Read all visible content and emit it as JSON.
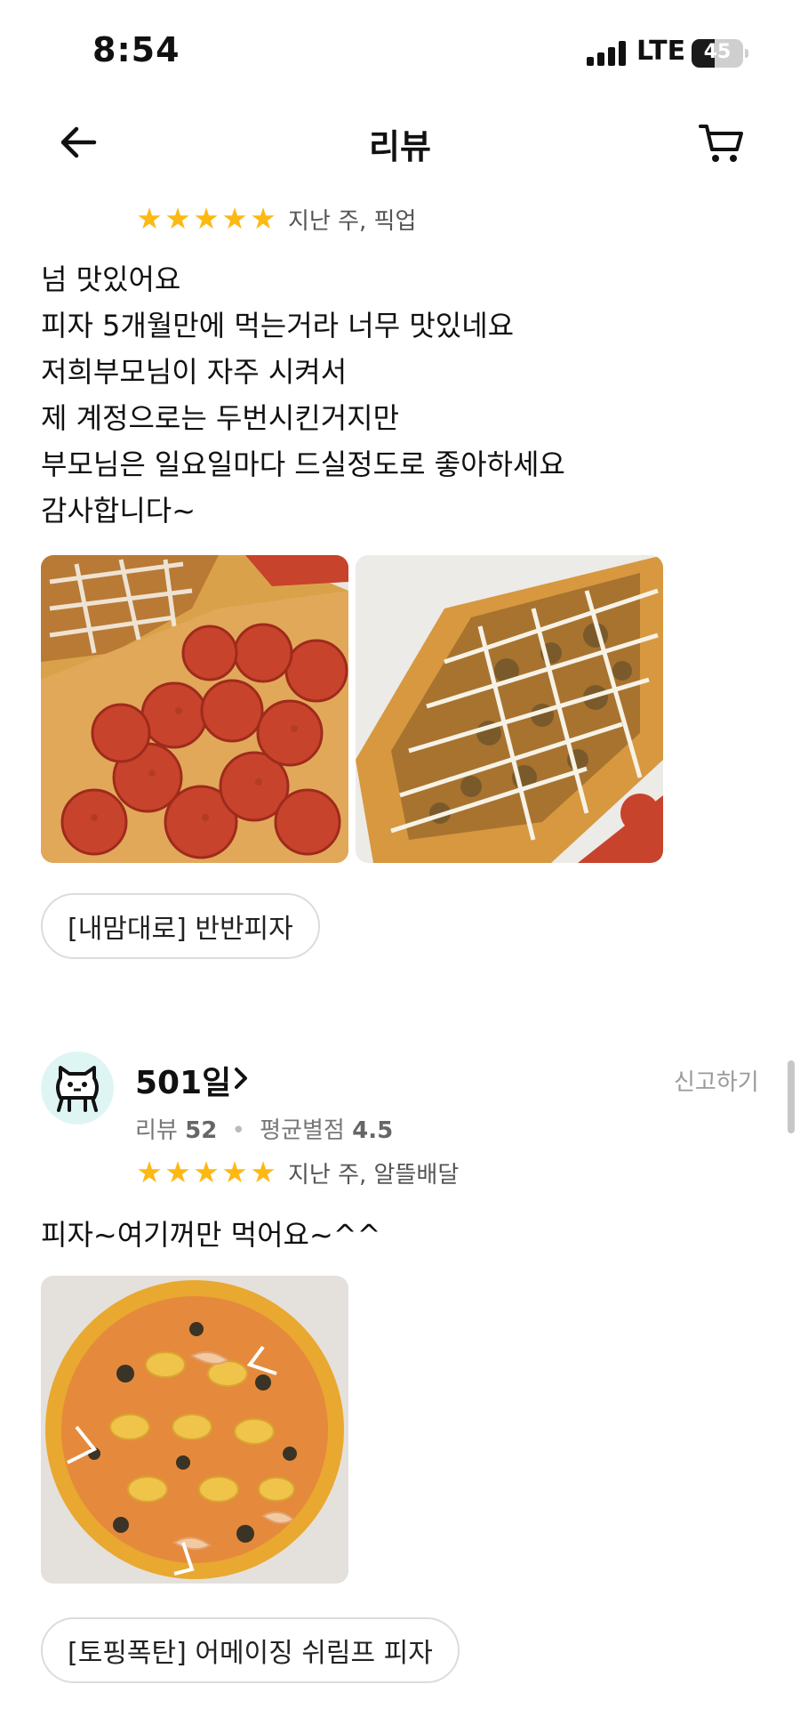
{
  "status_bar": {
    "time": "8:54",
    "network": "LTE",
    "battery_text": "45",
    "battery_level": 0.45
  },
  "header": {
    "title": "리뷰",
    "back_icon": "arrow-left-icon",
    "cart_icon": "cart-icon"
  },
  "reviews": [
    {
      "rating": 5,
      "meta": "지난 주, 픽업",
      "lines": [
        "넘 맛있어요",
        "피자 5개월만에 먹는거라 너무 맛있네요",
        "저희부모님이 자주 시켜서",
        "제 계정으로는 두번시킨거지만",
        "부모님은 일요일마다 드실정도로 좋아하세요",
        "감사합니다~"
      ],
      "photos": [
        "pepperoni-pizza-photo",
        "topped-pizza-photo"
      ],
      "menu_tag": "[내맘대로] 반반피자"
    },
    {
      "user": {
        "name": "501일",
        "avatar_icon": "cat-avatar-icon",
        "review_label": "리뷰",
        "review_count": "52",
        "avg_label": "평균별점",
        "avg_rating": "4.5"
      },
      "report_label": "신고하기",
      "rating": 5,
      "meta": "지난 주, 알뜰배달",
      "lines": [
        "피자~여기꺼만 먹어요~^^"
      ],
      "photos": [
        "shrimp-corn-pizza-photo"
      ],
      "menu_tag": "[토핑폭탄] 어메이징 쉬림프 피자"
    }
  ],
  "colors": {
    "star": "#fdb913",
    "chip_border": "#dcdcdc",
    "avatar_bg": "#dff5f3",
    "muted_text": "#9a9a9a"
  }
}
